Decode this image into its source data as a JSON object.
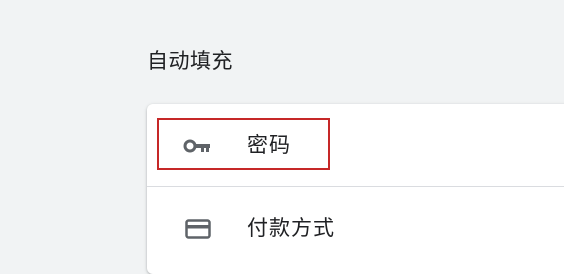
{
  "autofill": {
    "title": "自动填充",
    "items": [
      {
        "label": "密码",
        "icon": "key-icon"
      },
      {
        "label": "付款方式",
        "icon": "credit-card-icon"
      }
    ]
  },
  "colors": {
    "page_background": "#f1f3f4",
    "card_background": "#ffffff",
    "highlight_border": "#c62828",
    "text": "#202124",
    "icon": "#5f6368"
  }
}
